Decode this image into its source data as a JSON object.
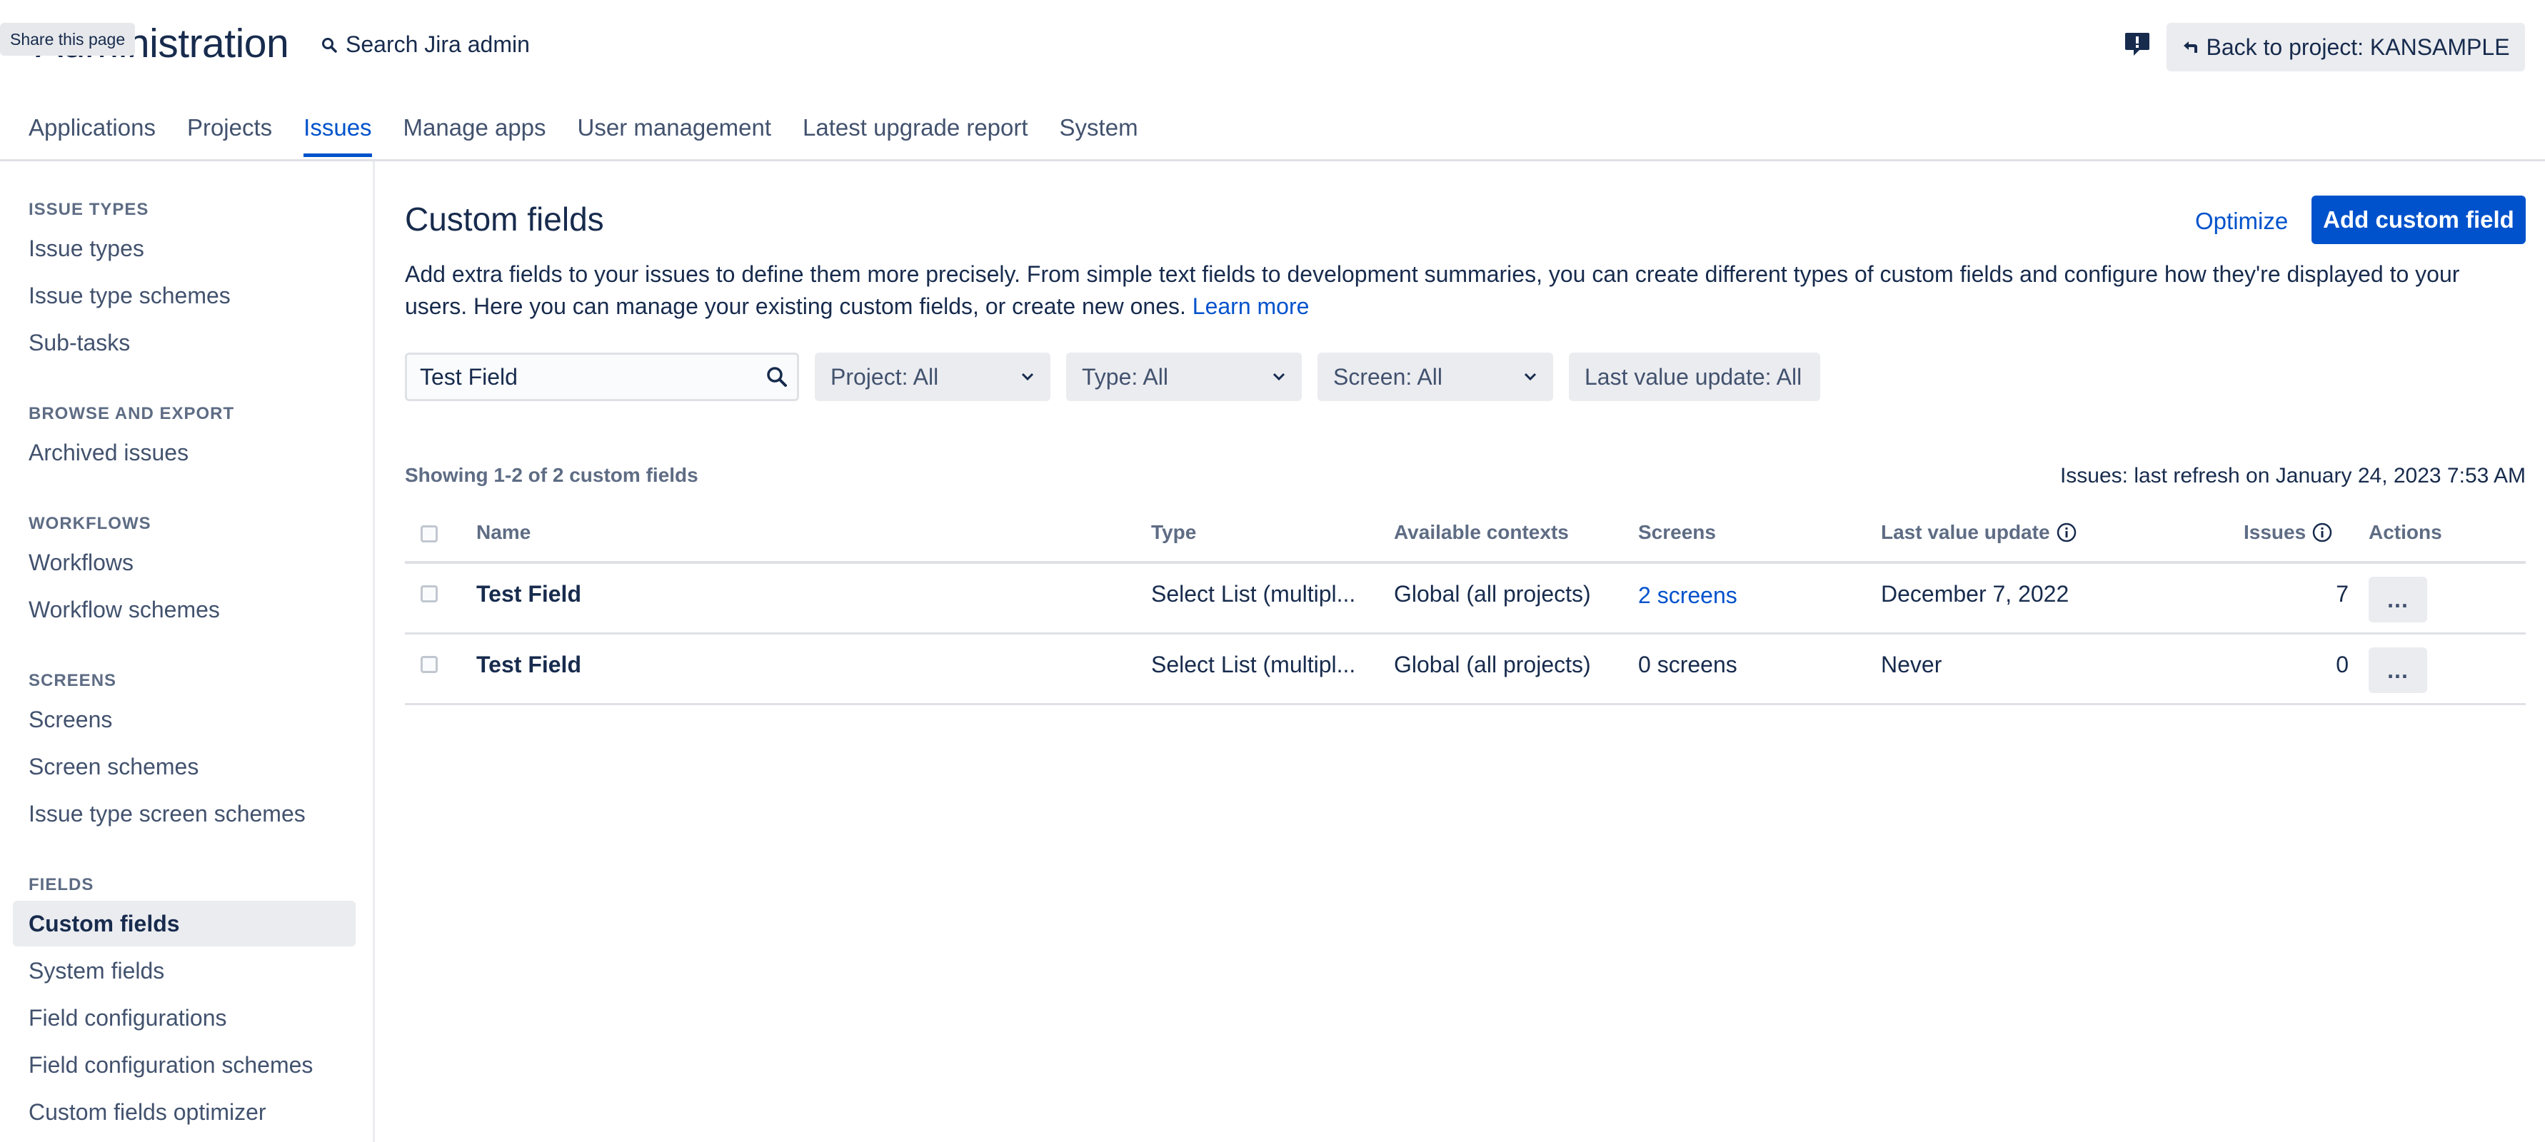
{
  "header": {
    "app_title": "Administration",
    "share_tooltip": "Share this page",
    "search_label": "Search Jira admin",
    "search_icon": "search-icon",
    "feedback_icon": "feedback-icon",
    "back_button": "Back to project: KANSAMPLE",
    "back_icon": "back-arrow-icon"
  },
  "nav": {
    "tabs": [
      {
        "label": "Applications"
      },
      {
        "label": "Projects"
      },
      {
        "label": "Issues"
      },
      {
        "label": "Manage apps"
      },
      {
        "label": "User management"
      },
      {
        "label": "Latest upgrade report"
      },
      {
        "label": "System"
      }
    ],
    "active_tab": "Issues"
  },
  "sidebar": {
    "sections": [
      {
        "title": "ISSUE TYPES",
        "items": [
          "Issue types",
          "Issue type schemes",
          "Sub-tasks"
        ]
      },
      {
        "title": "BROWSE AND EXPORT",
        "items": [
          "Archived issues"
        ]
      },
      {
        "title": "WORKFLOWS",
        "items": [
          "Workflows",
          "Workflow schemes"
        ]
      },
      {
        "title": "SCREENS",
        "items": [
          "Screens",
          "Screen schemes",
          "Issue type screen schemes"
        ]
      },
      {
        "title": "FIELDS",
        "items": [
          "Custom fields",
          "System fields",
          "Field configurations",
          "Field configuration schemes",
          "Custom fields optimizer"
        ]
      }
    ],
    "active_item": "Custom fields"
  },
  "main": {
    "title": "Custom fields",
    "optimize_label": "Optimize",
    "add_button_label": "Add custom field",
    "description": "Add extra fields to your issues to define them more precisely. From simple text fields to development summaries, you can create different types of custom fields and configure how they're displayed to your users. Here you can manage your existing custom fields, or create new ones.",
    "learn_more": "Learn more",
    "filters": {
      "search_value": "Test Field",
      "project": "Project: All",
      "type": "Type: All",
      "screen": "Screen: All",
      "last_value_update": "Last value update: All"
    },
    "showing": "Showing 1-2 of 2 custom fields",
    "refresh": "Issues: last refresh on January 24, 2023 7:53 AM",
    "table": {
      "headers": {
        "name": "Name",
        "type": "Type",
        "contexts": "Available contexts",
        "screens": "Screens",
        "last_update": "Last value update",
        "issues": "Issues",
        "actions": "Actions"
      },
      "rows": [
        {
          "name": "Test Field",
          "type": "Select List (multipl...",
          "contexts": "Global (all projects)",
          "screens": "2 screens",
          "screens_link": true,
          "last_update": "December 7, 2022",
          "issues": "7",
          "actions": "..."
        },
        {
          "name": "Test Field",
          "type": "Select List (multipl...",
          "contexts": "Global (all projects)",
          "screens": "0 screens",
          "screens_link": false,
          "last_update": "Never",
          "issues": "0",
          "actions": "..."
        }
      ]
    }
  },
  "colors": {
    "primary": "#0052cc",
    "text": "#172b4d",
    "muted": "#5e6c84",
    "subtle_bg": "#ebecf0"
  }
}
